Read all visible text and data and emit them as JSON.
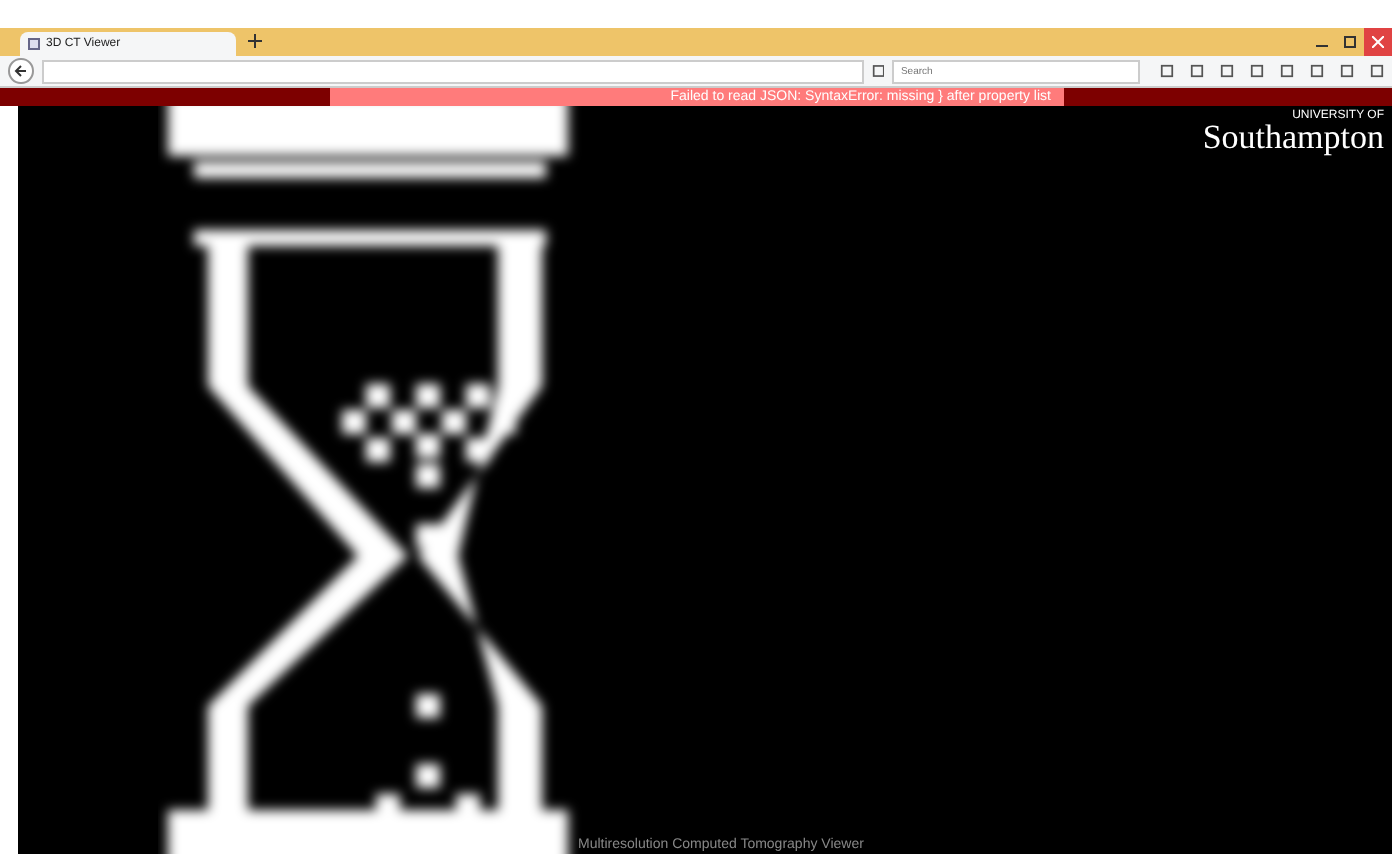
{
  "browser": {
    "tab": {
      "title": "3D CT Viewer",
      "selected": true
    },
    "search": {
      "placeholder": "Search"
    }
  },
  "error_banner": {
    "message": "Failed to read JSON: SyntaxError: missing } after property list"
  },
  "logo": {
    "line_1": "UNIVERSITY OF",
    "line_2": "Southampton"
  },
  "footer": {
    "text": "Multiresolution Computed Tomography Viewer"
  }
}
